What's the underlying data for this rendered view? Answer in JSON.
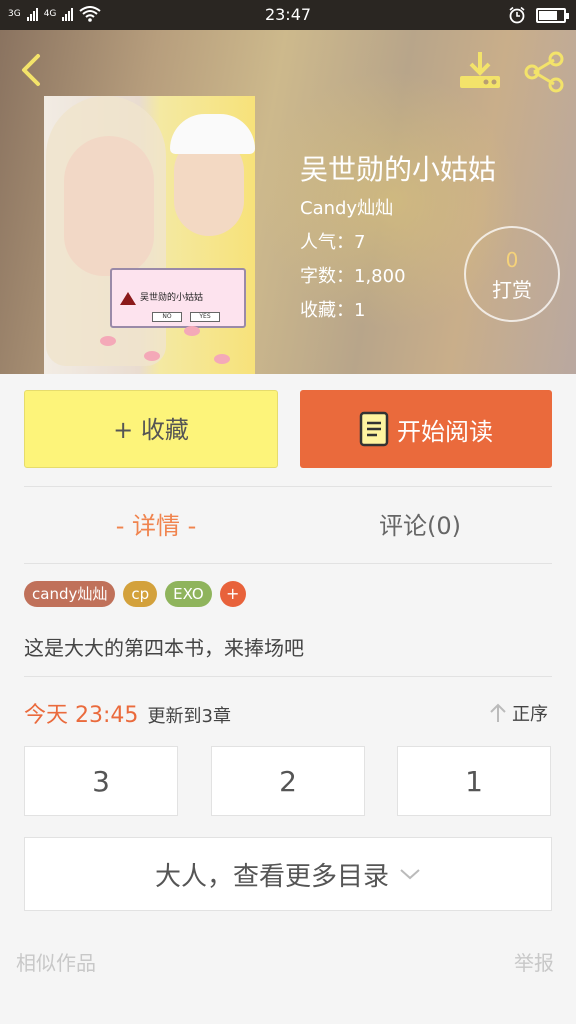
{
  "status_bar": {
    "sim1": "3G",
    "sim2": "4G",
    "time": "23:47"
  },
  "book": {
    "title": "吴世勋的小姑姑",
    "author": "Candy灿灿",
    "popularity": "人气：7",
    "word_count": "字数：1,800",
    "favorites": "收藏：1",
    "cover_text": "吴世勋的小姑姑",
    "cover_no": "NO",
    "cover_yes": "YES"
  },
  "reward": {
    "count": "0",
    "label": "打赏"
  },
  "actions": {
    "favorite_label": "+ 收藏",
    "read_label": "开始阅读"
  },
  "tabs": {
    "detail": "- 详情 -",
    "comments": "评论(0)"
  },
  "tags": [
    {
      "label": "candy灿灿",
      "color": "#c0715a"
    },
    {
      "label": "cp",
      "color": "#d3a13c"
    },
    {
      "label": "EXO",
      "color": "#8fb45c"
    },
    {
      "label": "+",
      "color": "#e8623b"
    }
  ],
  "description": "这是大大的第四本书，来捧场吧",
  "update": {
    "time": "今天 23:45",
    "chapter": "更新到3章",
    "order_label": "正序"
  },
  "chapters": [
    "3",
    "2",
    "1"
  ],
  "more_catalog": "大人，查看更多目录",
  "footer": {
    "similar": "相似作品",
    "report": "举报"
  },
  "colors": {
    "accent": "#ea6a3c",
    "favorite_bg": "#fdf47a",
    "tab_active": "#f0844e"
  }
}
